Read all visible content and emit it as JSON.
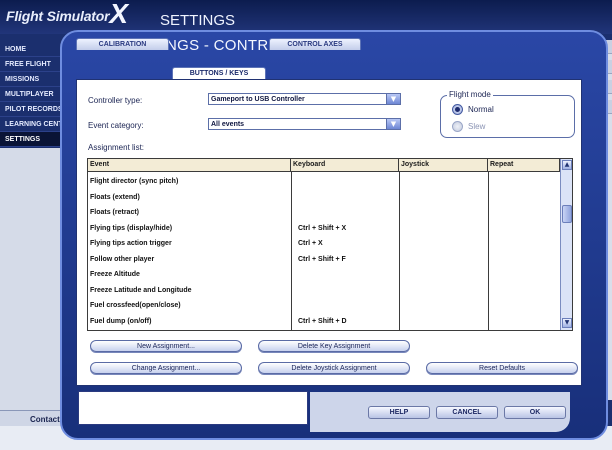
{
  "app": {
    "logo": "Flight Simulator",
    "logo_x": "X",
    "background_title": "SETTINGS"
  },
  "side_nav": [
    {
      "label": "HOME",
      "active": false
    },
    {
      "label": "FREE FLIGHT",
      "active": false
    },
    {
      "label": "MISSIONS",
      "active": false
    },
    {
      "label": "MULTIPLAYER",
      "active": false
    },
    {
      "label": "PILOT RECORDS",
      "active": false
    },
    {
      "label": "LEARNING CENTER",
      "active": false
    },
    {
      "label": "SETTINGS",
      "active": true
    }
  ],
  "contacts_label": "Contacts",
  "dialog": {
    "title": "SETTINGS - CONTROLS",
    "tabs": [
      {
        "label": "CALIBRATION",
        "active": false
      },
      {
        "label": "BUTTONS / KEYS",
        "active": true
      },
      {
        "label": "CONTROL AXES",
        "active": false
      }
    ],
    "controller_type_label": "Controller type:",
    "controller_type_value": "Gameport to USB Controller",
    "event_category_label": "Event category:",
    "event_category_value": "All events",
    "flight_mode": {
      "title": "Flight mode",
      "options": [
        {
          "label": "Normal",
          "checked": true,
          "disabled": false
        },
        {
          "label": "Slew",
          "checked": false,
          "disabled": true
        }
      ]
    },
    "assignment_list_label": "Assignment list:",
    "columns": [
      "Event",
      "Keyboard",
      "Joystick",
      "Repeat"
    ],
    "rows": [
      {
        "event": "Flight director (sync pitch)",
        "keyboard": "",
        "joystick": "",
        "repeat": ""
      },
      {
        "event": "Floats (extend)",
        "keyboard": "",
        "joystick": "",
        "repeat": ""
      },
      {
        "event": "Floats (retract)",
        "keyboard": "",
        "joystick": "",
        "repeat": ""
      },
      {
        "event": "Flying tips (display/hide)",
        "keyboard": "Ctrl + Shift + X",
        "joystick": "",
        "repeat": ""
      },
      {
        "event": "Flying tips action trigger",
        "keyboard": "Ctrl + X",
        "joystick": "",
        "repeat": ""
      },
      {
        "event": "Follow other player",
        "keyboard": "Ctrl + Shift + F",
        "joystick": "",
        "repeat": ""
      },
      {
        "event": "Freeze Altitude",
        "keyboard": "",
        "joystick": "",
        "repeat": ""
      },
      {
        "event": "Freeze Latitude and Longitude",
        "keyboard": "",
        "joystick": "",
        "repeat": ""
      },
      {
        "event": "Fuel crossfeed(open/close)",
        "keyboard": "",
        "joystick": "",
        "repeat": ""
      },
      {
        "event": "Fuel dump (on/off)",
        "keyboard": "Ctrl + Shift + D",
        "joystick": "",
        "repeat": ""
      }
    ],
    "buttons": {
      "new_assignment": "New Assignment...",
      "delete_key_assignment": "Delete Key Assignment",
      "change_assignment": "Change Assignment...",
      "delete_joystick_assignment": "Delete Joystick Assignment",
      "reset_defaults": "Reset Defaults"
    },
    "footer": {
      "help": "HELP",
      "cancel": "CANCEL",
      "ok": "OK"
    }
  },
  "colors": {
    "dialog_blue": "#2a47a6",
    "header_tan": "#f3ecd6",
    "nav_active": "#0a1436"
  }
}
